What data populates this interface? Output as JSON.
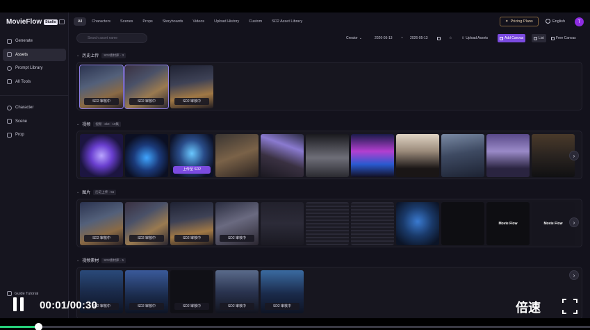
{
  "brand": {
    "name": "MovieFlow",
    "badge": "Studio"
  },
  "sidebar": {
    "items": [
      {
        "label": "Generate",
        "active": false
      },
      {
        "label": "Assets",
        "active": true
      },
      {
        "label": "Prompt Library",
        "active": false
      },
      {
        "label": "All Tools",
        "active": false
      }
    ],
    "items2": [
      {
        "label": "Character"
      },
      {
        "label": "Scene"
      },
      {
        "label": "Prop"
      }
    ],
    "guide": "Guide Tutorial"
  },
  "topbar": {
    "tabs": [
      "All",
      "Characters",
      "Scenes",
      "Props",
      "Storyboards",
      "Videos",
      "Upload History",
      "Custom",
      "SD2 Asset Library"
    ],
    "active_tab": "All",
    "pricing": "Pricing Plans",
    "language": "English",
    "avatar_initial": "T"
  },
  "toolbar": {
    "search_placeholder": "Search asset name",
    "creator": "Creator",
    "date_from": "2026-05-13",
    "date_sep": "~",
    "date_to": "2026-05-13",
    "upload": "Upload Assets",
    "add_canvas": "Add Canvas",
    "list": "List",
    "free_canvas": "Free Canvas"
  },
  "sections": [
    {
      "title": "历史上传",
      "badge": "SD2素材库 · 3"
    },
    {
      "title": "视频",
      "badge": "视频 · 2k0 · 10集"
    },
    {
      "title": "图片",
      "badge": "历史上传 · 56"
    },
    {
      "title": "视频素材",
      "badge": "SD2素材库 · 5"
    }
  ],
  "labels": {
    "sd2_review": "SD2 审核中",
    "upload_sd2": "上传至 SD2",
    "brand_mark": "Movie Flow"
  },
  "player": {
    "time": "00:01/00:30",
    "speed": "倍速",
    "progress": 0.065
  },
  "colors": {
    "accent": "#7b4be0",
    "background": "#13121c",
    "progress": "#27d07a"
  }
}
